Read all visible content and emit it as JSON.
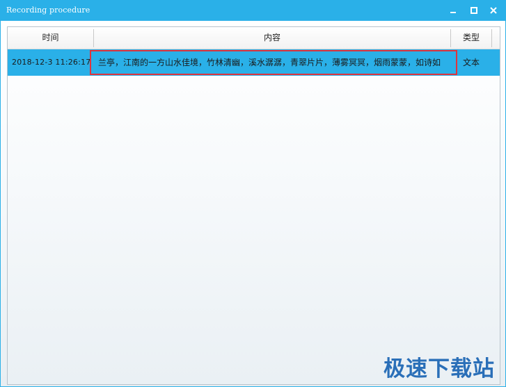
{
  "window": {
    "title": "Recording procedure"
  },
  "table": {
    "columns": [
      "时间",
      "内容",
      "类型"
    ],
    "rows": [
      {
        "time": "2018-12-3 11:26:17",
        "content": "兰亭，江南的一方山水佳境，竹林清幽，溪水潺潺，青翠片片，薄雾冥冥，烟雨蒙蒙，如诗如",
        "type": "文本"
      }
    ]
  },
  "watermark": {
    "text": "极速下载站"
  },
  "colors": {
    "titlebar": "#2ab0e8",
    "selected_row": "#2ab0e8",
    "highlight_border": "#e0343c",
    "watermark": "#2a6fb8"
  },
  "icons": [
    "minimize-icon",
    "maximize-icon",
    "close-icon"
  ]
}
